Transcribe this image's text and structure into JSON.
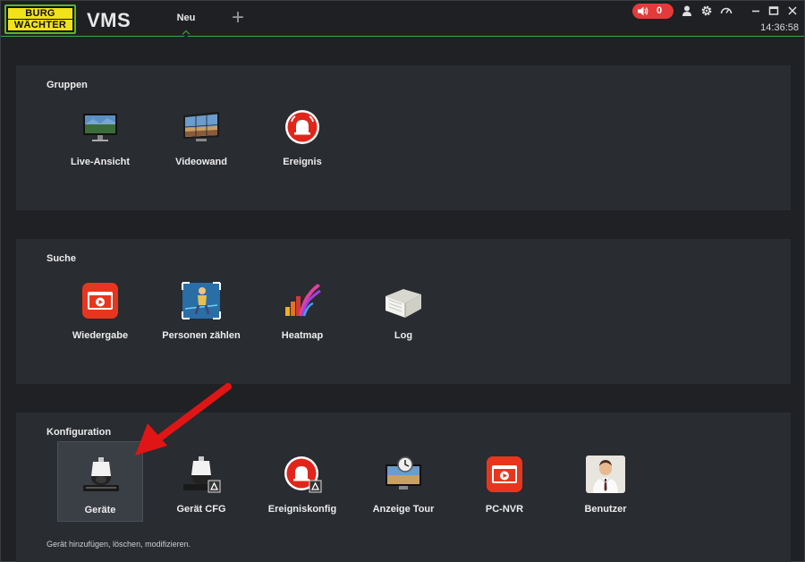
{
  "header": {
    "logo_line1": "BURG",
    "logo_line2": "WÄCHTER",
    "app_title": "VMS",
    "tab_label": "Neu",
    "add_tab": "+",
    "alarm_count": "0",
    "clock": "14:36:58"
  },
  "sections": {
    "gruppen": {
      "title": "Gruppen",
      "items": [
        "Live-Ansicht",
        "Videowand",
        "Ereignis"
      ]
    },
    "suche": {
      "title": "Suche",
      "items": [
        "Wiedergabe",
        "Personen zählen",
        "Heatmap",
        "Log"
      ]
    },
    "konfiguration": {
      "title": "Konfiguration",
      "items": [
        "Geräte",
        "Gerät CFG",
        "Ereigniskonfig",
        "Anzeige Tour",
        "PC-NVR",
        "Benutzer"
      ],
      "hint": "Gerät hinzufügen, löschen, modifizieren."
    }
  },
  "colors": {
    "accent_green": "#3ba84a",
    "alarm_red": "#e33b3b",
    "arrow_red": "#e01515",
    "panel_bg": "#292c31"
  },
  "icons": [
    "speaker-icon",
    "user-icon",
    "gear-icon",
    "speed-icon",
    "minimize-icon",
    "maximize-icon",
    "close-icon"
  ]
}
